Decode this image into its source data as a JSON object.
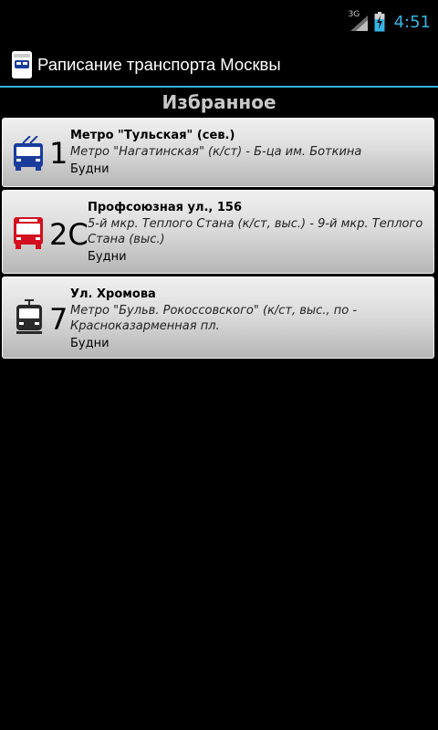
{
  "status_bar": {
    "network_type": "3G",
    "time": "4:51",
    "icons": [
      "signal-icon",
      "battery-charging-icon"
    ]
  },
  "action_bar": {
    "title": "Раписание транспорта Москвы",
    "icon": "bus-stop-app-icon"
  },
  "section": {
    "title": "Избранное"
  },
  "favorites": [
    {
      "vehicle": "trolleybus",
      "icon": "trolleybus-icon",
      "color": "#1a3d9c",
      "route": "1",
      "stop": "Метро \"Тульская\" (сев.)",
      "direction": "Метро \"Нагатинская\" (к/ст) - Б-ца им. Боткина",
      "days": "Будни"
    },
    {
      "vehicle": "bus",
      "icon": "bus-icon",
      "color": "#d4101e",
      "route": "2С",
      "stop": "Профсоюзная ул., 156",
      "direction": "5-й мкр. Теплого Стана (к/ст, выс.) - 9-й мкр. Теплого Стана (выс.)",
      "days": "Будни"
    },
    {
      "vehicle": "tram",
      "icon": "tram-icon",
      "color": "#2a2a2a",
      "route": "7",
      "stop": "Ул. Хромова",
      "direction": "Метро \"Бульв. Рокоссовского\" (к/ст, выс., по - Красноказарменная пл.",
      "days": "Будни"
    }
  ]
}
